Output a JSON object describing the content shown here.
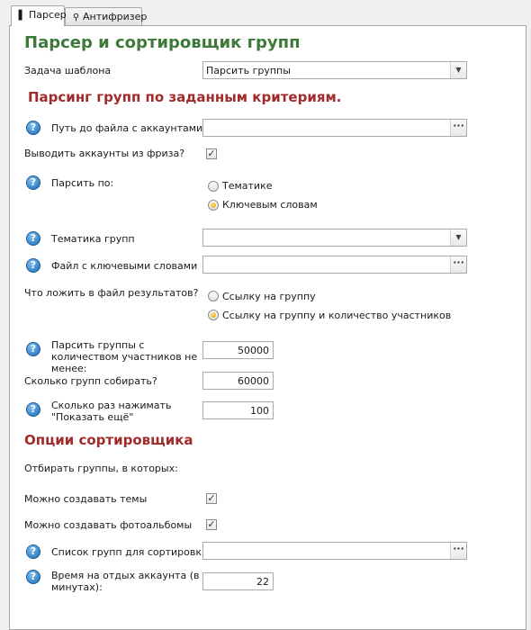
{
  "tabs": [
    {
      "label": "Парсер",
      "icon": "parser-tab-icon",
      "active": true
    },
    {
      "label": "Антифризер",
      "icon": "magnifier-icon",
      "active": false
    }
  ],
  "header": {
    "title": "Парсер и сортировщик групп"
  },
  "template": {
    "label": "Задача шаблона",
    "value": "Парсить группы"
  },
  "section1": {
    "title": "Парсинг групп по заданным критериям."
  },
  "accounts_file": {
    "label": "Путь до файла с аккаунтами",
    "value": "",
    "browse": "···"
  },
  "freeze": {
    "label": "Выводить аккаунты из фриза?",
    "checked": true
  },
  "parse_by": {
    "label": "Парсить по:",
    "options": [
      {
        "label": "Тематике",
        "selected": false
      },
      {
        "label": "Ключевым словам",
        "selected": true
      }
    ]
  },
  "topic": {
    "label": "Тематика групп",
    "value": ""
  },
  "keywords_file": {
    "label": "Файл с ключевыми словами",
    "value": "",
    "browse": "···"
  },
  "result_content": {
    "label": "Что ложить в файл результатов?",
    "options": [
      {
        "label": "Ссылку на группу",
        "selected": false
      },
      {
        "label": "Ссылку на группу и количество участников",
        "selected": true
      }
    ]
  },
  "min_members": {
    "label": "Парсить группы с количеством участников не менее:",
    "value": "50000"
  },
  "groups_count": {
    "label": "Сколько групп собирать?",
    "value": "60000"
  },
  "show_more": {
    "label": "Сколько раз нажимать \"Показать ещё\"",
    "value": "100"
  },
  "section2": {
    "title": "Опции сортировщика"
  },
  "filter_intro": {
    "label": "Отбирать группы, в которых:"
  },
  "can_topics": {
    "label": "Можно создавать темы",
    "checked": true
  },
  "can_albums": {
    "label": "Можно создавать фотоальбомы",
    "checked": true
  },
  "sort_list": {
    "label": "Список групп для сортировки",
    "value": "",
    "browse": "···"
  },
  "rest_time": {
    "label": "Время на отдых аккаунта (в минутах):",
    "value": "22"
  },
  "icons": {
    "help": "?",
    "check": "✓",
    "dropdown": "▼"
  }
}
